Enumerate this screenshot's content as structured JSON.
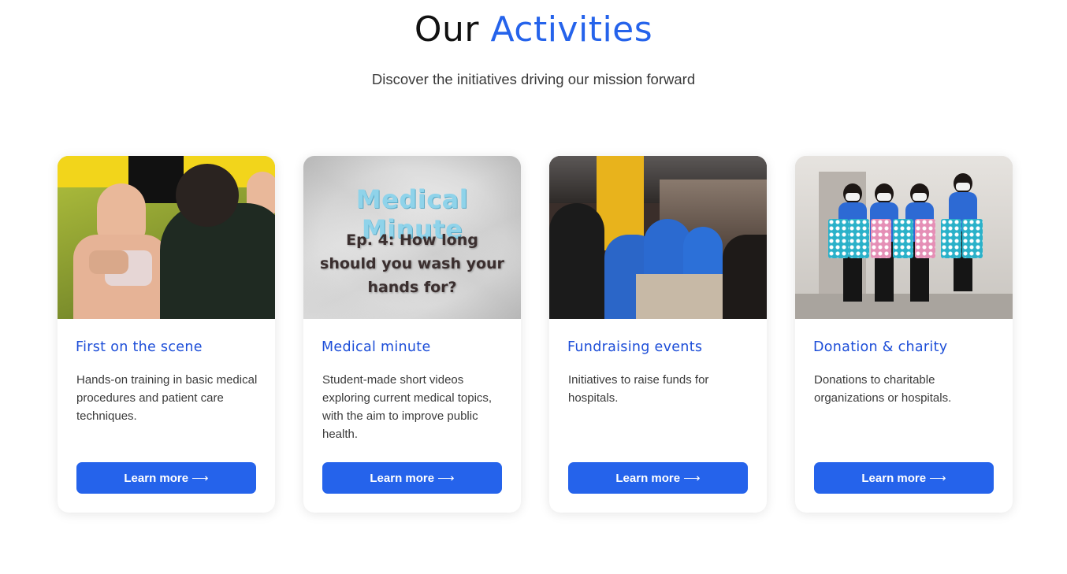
{
  "header": {
    "title_plain": "Our",
    "title_accent": "Activities",
    "subtitle": "Discover the initiatives driving our mission forward"
  },
  "colors": {
    "accent": "#2563eb",
    "title_blue": "#1d4ed8",
    "text": "#3a3a3a"
  },
  "cards": [
    {
      "image_icon": "cpr-training-photo",
      "title": "First on the scene",
      "description": "Hands-on training in basic medical procedures and patient care techniques.",
      "button_label": "Learn more",
      "button_arrow": "⟶"
    },
    {
      "image_icon": "medical-minute-graphic",
      "image_title": "Medical Minute",
      "image_subtitle": "Ep. 4: How long should you wash your hands for?",
      "title": "Medical minute",
      "description": "Student-made short videos exploring current medical topics, with the aim to improve public health.",
      "button_label": "Learn more",
      "button_arrow": "⟶"
    },
    {
      "image_icon": "fundraising-photo",
      "title": "Fundraising events",
      "description": "Initiatives to raise funds for hospitals.",
      "button_label": "Learn more",
      "button_arrow": "⟶"
    },
    {
      "image_icon": "donation-photo",
      "title": "Donation & charity",
      "description": "Donations to charitable organizations or hospitals.",
      "button_label": "Learn more",
      "button_arrow": "⟶"
    }
  ]
}
